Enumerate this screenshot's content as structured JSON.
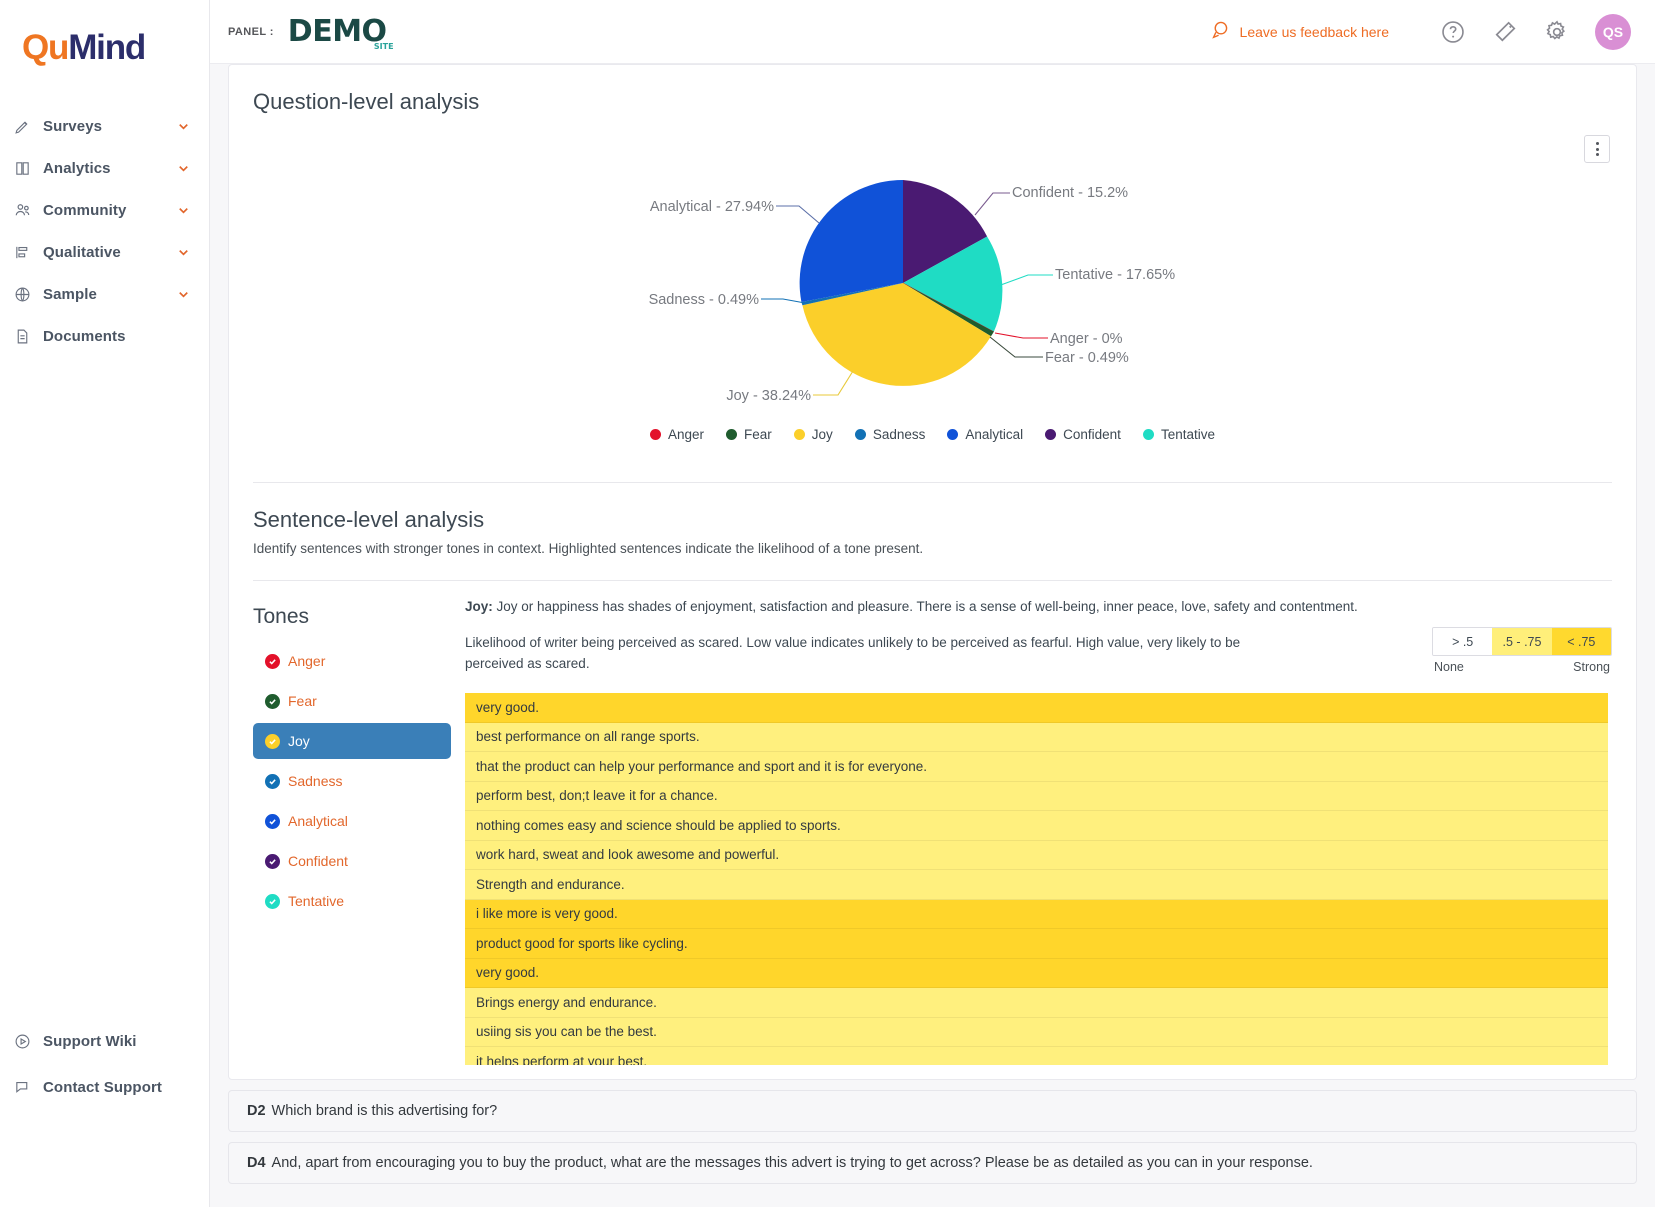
{
  "brand": {
    "name_part1": "Qu",
    "name_part2": "Mind"
  },
  "sidebar": {
    "items": [
      {
        "label": "Surveys",
        "icon": "pencil-icon",
        "caret": true
      },
      {
        "label": "Analytics",
        "icon": "book-icon",
        "caret": true
      },
      {
        "label": "Community",
        "icon": "people-icon",
        "caret": true
      },
      {
        "label": "Qualitative",
        "icon": "bars-icon",
        "caret": true
      },
      {
        "label": "Sample",
        "icon": "globe-icon",
        "caret": true
      },
      {
        "label": "Documents",
        "icon": "document-icon",
        "caret": false
      }
    ],
    "bottom": [
      {
        "label": "Support Wiki",
        "icon": "play-circle-icon"
      },
      {
        "label": "Contact Support",
        "icon": "chat-icon"
      }
    ]
  },
  "topbar": {
    "panel_label": "PANEL :",
    "demo_logo": "DEMO",
    "demo_logo_sub": "SITE",
    "feedback_text": "Leave us feedback here",
    "icons": [
      "help-icon",
      "ticket-icon",
      "gear-icon"
    ],
    "avatar_initials": "QS"
  },
  "question_level": {
    "title": "Question-level analysis",
    "menu_icon": "kebab-menu-icon"
  },
  "chart_data": {
    "type": "pie",
    "title": "Question-level analysis",
    "legend_position": "bottom",
    "categories": [
      "Anger",
      "Fear",
      "Joy",
      "Sadness",
      "Analytical",
      "Confident",
      "Tentative"
    ],
    "values": [
      0,
      0.49,
      38.24,
      0.49,
      27.94,
      15.2,
      17.65
    ],
    "colors": [
      "#e3112a",
      "#1f5c2e",
      "#fbcf2a",
      "#1271b5",
      "#1052d8",
      "#4a1a72",
      "#1fdcc4"
    ],
    "labels": [
      "Anger - 0%",
      "Fear - 0.49%",
      "Joy - 38.24%",
      "Sadness - 0.49%",
      "Analytical - 27.94%",
      "Confident - 15.2%",
      "Tentative - 17.65%"
    ],
    "unit": "%"
  },
  "sentence_level": {
    "title": "Sentence-level analysis",
    "subtitle": "Identify sentences with stronger tones in context. Highlighted sentences indicate the likelihood of a tone present.",
    "tones_title": "Tones",
    "tones": [
      {
        "label": "Anger",
        "color": "#e3112a",
        "active": false
      },
      {
        "label": "Fear",
        "color": "#1f5c2e",
        "active": false
      },
      {
        "label": "Joy",
        "color": "#fbcf2a",
        "active": true
      },
      {
        "label": "Sadness",
        "color": "#1271b5",
        "active": false
      },
      {
        "label": "Analytical",
        "color": "#1052d8",
        "active": false
      },
      {
        "label": "Confident",
        "color": "#4a1a72",
        "active": false
      },
      {
        "label": "Tentative",
        "color": "#1fdcc4",
        "active": false
      }
    ],
    "tone_name": "Joy:",
    "tone_description": " Joy or happiness has shades of enjoyment, satisfaction and pleasure. There is a sense of well-being, inner peace, love, safety and contentment.",
    "tone_hint": "Likelihood of writer being perceived as scared. Low value indicates unlikely to be perceived as fearful. High value, very likely to be perceived as scared.",
    "scale": {
      "buckets": [
        "> .5",
        ".5 - .75",
        "< .75"
      ],
      "left_label": "None",
      "right_label": "Strong"
    },
    "sentences": [
      {
        "text": "very good.",
        "level": "strong"
      },
      {
        "text": "best performance on all range sports.",
        "level": "mid"
      },
      {
        "text": "that the product can help your performance and sport and it is for everyone.",
        "level": "mid"
      },
      {
        "text": "perform best, don;t leave it for a chance.",
        "level": "mid"
      },
      {
        "text": "nothing comes easy and science should be applied to sports.",
        "level": "mid"
      },
      {
        "text": "work hard, sweat and look awesome and powerful.",
        "level": "mid"
      },
      {
        "text": "Strength and endurance.",
        "level": "mid"
      },
      {
        "text": "i like more is very good.",
        "level": "strong"
      },
      {
        "text": "product good for sports like cycling.",
        "level": "strong"
      },
      {
        "text": "very good.",
        "level": "strong"
      },
      {
        "text": "Brings energy and endurance.",
        "level": "mid"
      },
      {
        "text": "usiing sis you can be the best.",
        "level": "mid"
      },
      {
        "text": "it helps perform at your best.",
        "level": "mid"
      }
    ]
  },
  "questions": [
    {
      "id": "D2",
      "text": "Which brand is this advertising for?"
    },
    {
      "id": "D4",
      "text": "And, apart from encouraging you to buy the product, what are the messages this advert is trying to get across? Please be as detailed as you can in your response."
    }
  ]
}
